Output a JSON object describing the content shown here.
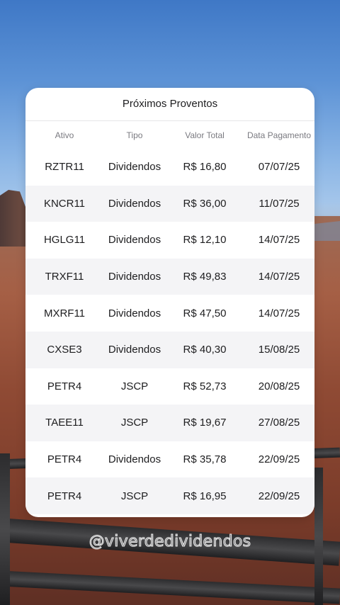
{
  "title": "Próximos Proventos",
  "headers": {
    "ativo": "Ativo",
    "tipo": "Tipo",
    "valor": "Valor Total",
    "data": "Data Pagamento"
  },
  "rows": [
    {
      "ativo": "RZTR11",
      "tipo": "Dividendos",
      "valor": "R$ 16,80",
      "data": "07/07/25"
    },
    {
      "ativo": "KNCR11",
      "tipo": "Dividendos",
      "valor": "R$ 36,00",
      "data": "11/07/25"
    },
    {
      "ativo": "HGLG11",
      "tipo": "Dividendos",
      "valor": "R$ 12,10",
      "data": "14/07/25"
    },
    {
      "ativo": "TRXF11",
      "tipo": "Dividendos",
      "valor": "R$ 49,83",
      "data": "14/07/25"
    },
    {
      "ativo": "MXRF11",
      "tipo": "Dividendos",
      "valor": "R$ 47,50",
      "data": "14/07/25"
    },
    {
      "ativo": "CXSE3",
      "tipo": "Dividendos",
      "valor": "R$ 40,30",
      "data": "15/08/25"
    },
    {
      "ativo": "PETR4",
      "tipo": "JSCP",
      "valor": "R$ 52,73",
      "data": "20/08/25"
    },
    {
      "ativo": "TAEE11",
      "tipo": "JSCP",
      "valor": "R$ 19,67",
      "data": "27/08/25"
    },
    {
      "ativo": "PETR4",
      "tipo": "Dividendos",
      "valor": "R$ 35,78",
      "data": "22/09/25"
    },
    {
      "ativo": "PETR4",
      "tipo": "JSCP",
      "valor": "R$ 16,95",
      "data": "22/09/25"
    }
  ],
  "watermark": "@viverdedividendos",
  "colors": {
    "card": "#ffffff",
    "alt_row": "#f4f4f6",
    "text": "#1d1d1f",
    "header_text": "#7a7a80"
  }
}
